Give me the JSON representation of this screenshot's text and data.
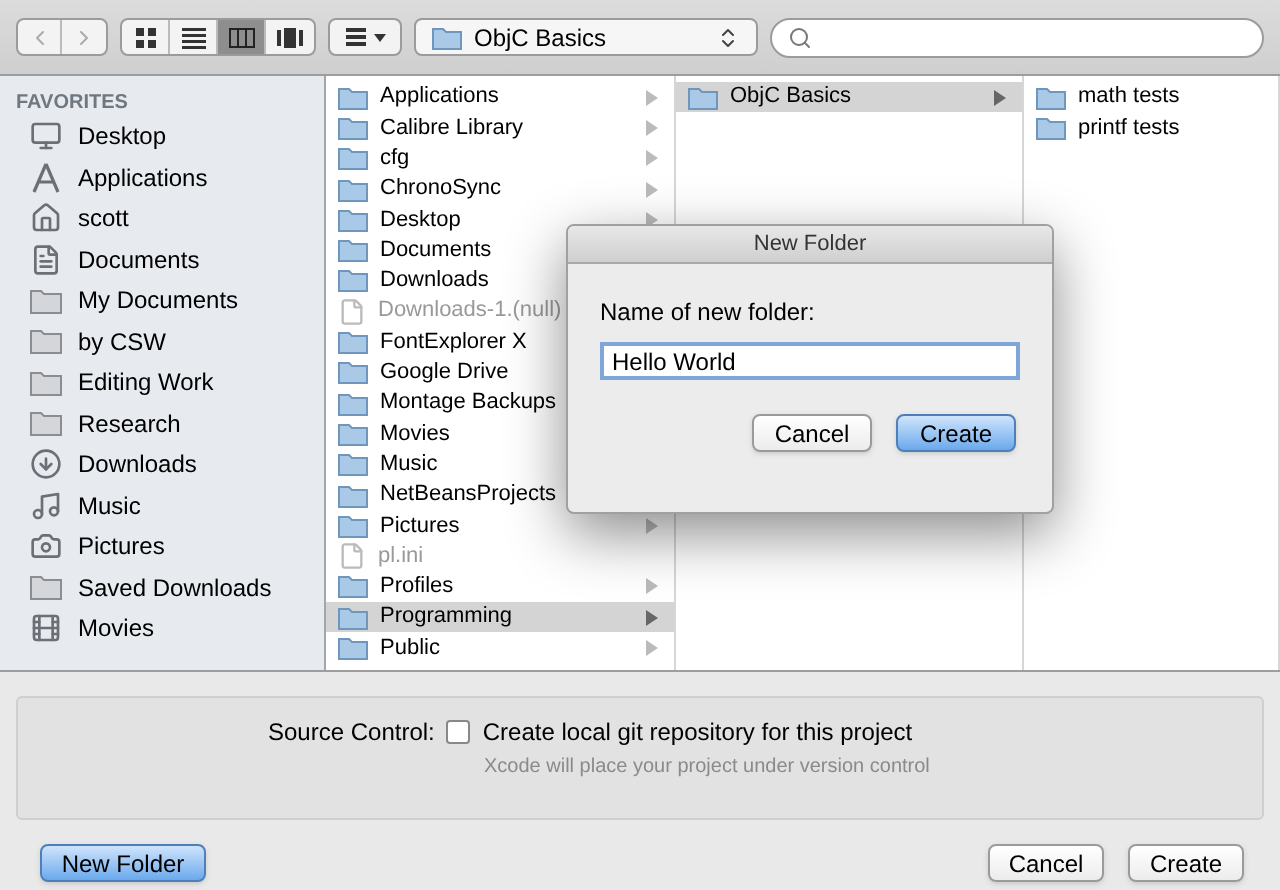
{
  "toolbar": {
    "view_modes": [
      {
        "kind": "icons",
        "selected": false
      },
      {
        "kind": "list",
        "selected": false
      },
      {
        "kind": "columns",
        "selected": true
      },
      {
        "kind": "coverflow",
        "selected": false
      }
    ],
    "path_popup": "ObjC Basics"
  },
  "sidebar": {
    "heading": "FAVORITES",
    "items": [
      {
        "label": "Desktop",
        "kind": "desktop"
      },
      {
        "label": "Applications",
        "kind": "apps"
      },
      {
        "label": "scott",
        "kind": "home"
      },
      {
        "label": "Documents",
        "kind": "document"
      },
      {
        "label": "My Documents",
        "kind": "folder"
      },
      {
        "label": "by CSW",
        "kind": "folder"
      },
      {
        "label": "Editing Work",
        "kind": "folder"
      },
      {
        "label": "Research",
        "kind": "folder"
      },
      {
        "label": "Downloads",
        "kind": "download"
      },
      {
        "label": "Music",
        "kind": "music"
      },
      {
        "label": "Pictures",
        "kind": "camera"
      },
      {
        "label": "Saved Downloads",
        "kind": "folder"
      },
      {
        "label": "Movies",
        "kind": "movies"
      }
    ]
  },
  "columns": [
    {
      "items": [
        {
          "label": "Applications",
          "kind": "folder",
          "has_children": true,
          "disabled": false,
          "selected": false
        },
        {
          "label": "Calibre Library",
          "kind": "folder",
          "has_children": true,
          "disabled": false,
          "selected": false
        },
        {
          "label": "cfg",
          "kind": "folder",
          "has_children": true,
          "disabled": false,
          "selected": false
        },
        {
          "label": "ChronoSync",
          "kind": "folder",
          "has_children": true,
          "disabled": false,
          "selected": false
        },
        {
          "label": "Desktop",
          "kind": "folder",
          "has_children": true,
          "disabled": false,
          "selected": false
        },
        {
          "label": "Documents",
          "kind": "folder",
          "disabled": false,
          "selected": false
        },
        {
          "label": "Downloads",
          "kind": "folder",
          "disabled": false,
          "selected": false
        },
        {
          "label": "Downloads-1.(null)",
          "kind": "file",
          "has_children": false,
          "disabled": true,
          "selected": false
        },
        {
          "label": "FontExplorer X",
          "kind": "folder",
          "disabled": false,
          "selected": false
        },
        {
          "label": "Google Drive",
          "kind": "folder",
          "disabled": false,
          "selected": false
        },
        {
          "label": "Montage Backups",
          "kind": "folder",
          "disabled": false,
          "selected": false
        },
        {
          "label": "Movies",
          "kind": "folder",
          "disabled": false,
          "selected": false
        },
        {
          "label": "Music",
          "kind": "folder",
          "disabled": false,
          "selected": false
        },
        {
          "label": "NetBeansProjects",
          "kind": "folder",
          "disabled": false,
          "selected": false
        },
        {
          "label": "Pictures",
          "kind": "folder",
          "has_children": true,
          "disabled": false,
          "selected": false
        },
        {
          "label": "pl.ini",
          "kind": "file",
          "has_children": false,
          "disabled": true,
          "selected": false
        },
        {
          "label": "Profiles",
          "kind": "folder",
          "has_children": true,
          "disabled": false,
          "selected": false
        },
        {
          "label": "Programming",
          "kind": "folder",
          "has_children": true,
          "disabled": false,
          "selected": true
        },
        {
          "label": "Public",
          "kind": "folder",
          "has_children": true,
          "disabled": false,
          "selected": false
        }
      ]
    },
    {
      "items": [
        {
          "label": "ObjC Basics",
          "kind": "folder",
          "has_children": true,
          "disabled": false,
          "selected": true
        }
      ]
    },
    {
      "items": [
        {
          "label": "math tests",
          "kind": "folder",
          "has_children": false,
          "disabled": false,
          "selected": false
        },
        {
          "label": "printf tests",
          "kind": "folder",
          "has_children": false,
          "disabled": false,
          "selected": false
        }
      ]
    }
  ],
  "new_folder_dialog": {
    "title": "New Folder",
    "prompt": "Name of new folder:",
    "value": "Hello World",
    "buttons": [
      {
        "label": "Cancel",
        "default": false
      },
      {
        "label": "Create",
        "default": true
      }
    ]
  },
  "options": {
    "label": "Source Control:",
    "checkbox": {
      "label": "Create local git repository for this project",
      "checked": false
    },
    "hint": "Xcode will place your project under version control"
  },
  "footer": {
    "new_folder": "New Folder",
    "buttons": [
      {
        "label": "Cancel",
        "default": false
      },
      {
        "label": "Create",
        "default": false
      }
    ]
  }
}
